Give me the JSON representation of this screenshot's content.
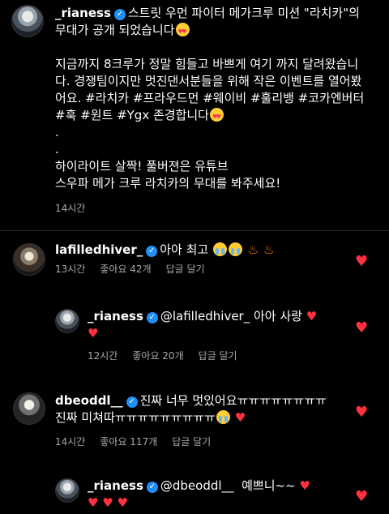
{
  "post": {
    "username": "_rianess",
    "caption_line1": "스트릿 우먼 파이터 메가크루 미션 \"라치카\"의",
    "caption_line2": "무대가 공개 되었습니다",
    "paragraph1_line1": "지금까지 8크루가 정말 힘들고 바쁘게 여기 까지 달려왔습니",
    "paragraph1_line2": "다. 경쟁팀이지만 멋진댄서분들을 위해 작은 이벤트를 열어봤",
    "paragraph1_line3": "어요. #라치카 #프라우드먼 #웨이비 #훌리뱅 #코카엔버터",
    "paragraph1_line4": "#훅 #원트 #Ygx 존경합니다",
    "dot1": ".",
    "dot2": ".",
    "highlight_line1": "하이라이트 살짝! 풀버젼은 유튜브",
    "highlight_line2": "스우파 메가 크루 라치카의 무대를 봐주세요!",
    "time": "14시간"
  },
  "comments": [
    {
      "username": "lafilledhiver_",
      "text": "아아 최고",
      "time": "13시간",
      "likes": "좋아요 42개",
      "reply": "답글 달기"
    },
    {
      "username": "_rianess",
      "mention": "@lafilledhiver_",
      "text": "아아 사랑",
      "time": "12시간",
      "likes": "좋아요 20개",
      "reply": "답글 달기"
    },
    {
      "username": "dbeoddl__",
      "text_line1": "진짜 너무 멋있어요ㅠㅠㅠㅠㅠㅠㅠㅠ",
      "text_line2": "진짜 미쳐따ㅠㅠㅠㅠㅠㅠㅠㅠㅠ",
      "time": "14시간",
      "likes": "좋아요 117개",
      "reply": "답글 달기"
    },
    {
      "username": "_rianess",
      "mention": "@dbeoddl__",
      "text": "예쁘니~~"
    }
  ],
  "icons": {
    "verified": "✓",
    "heart": "♥"
  },
  "colors": {
    "accent_red": "#ff3040",
    "verified_blue": "#1f8ff7",
    "muted": "#a8a8a8"
  }
}
